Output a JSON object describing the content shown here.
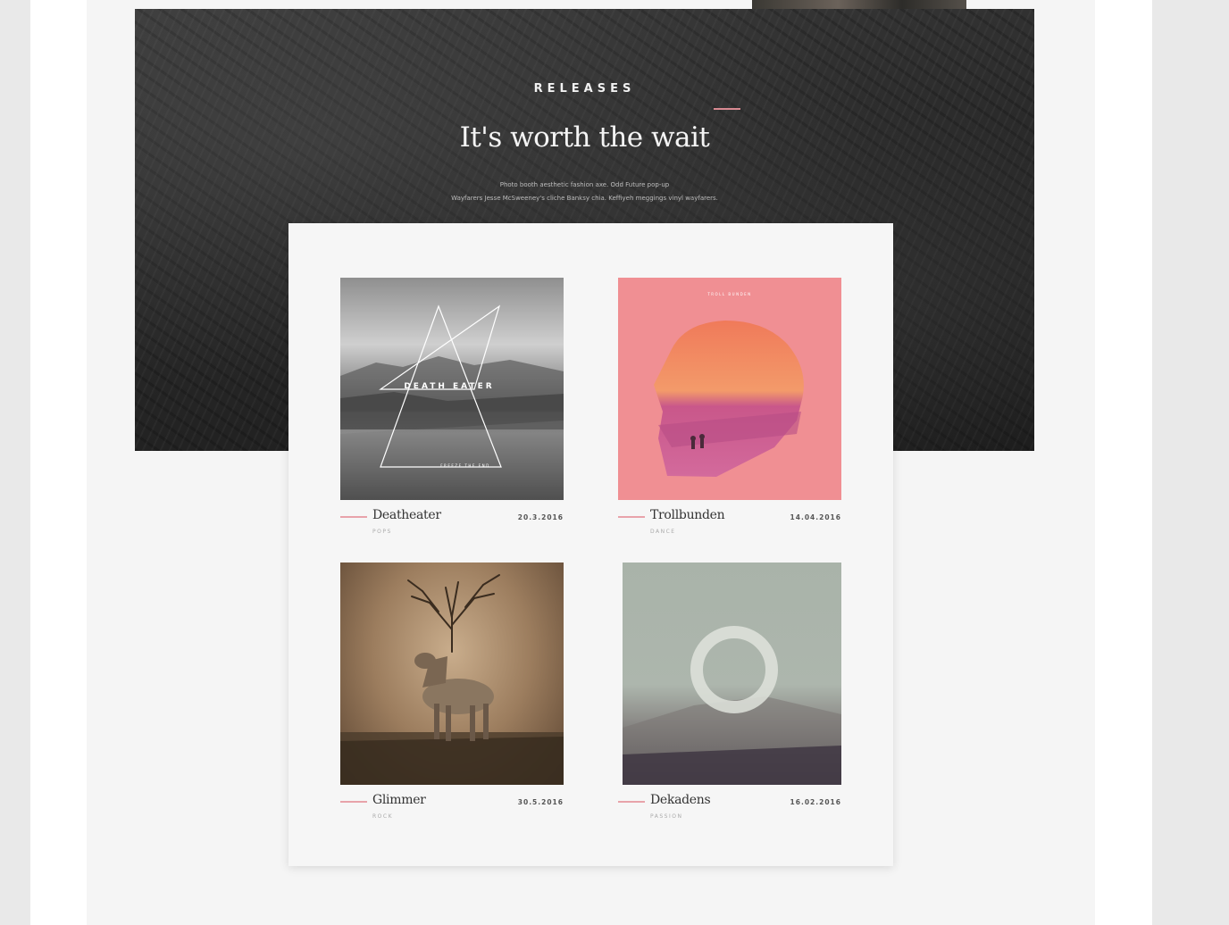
{
  "hero": {
    "eyebrow": "RELEASES",
    "headline": "It's worth the wait",
    "intro_line1": "Photo booth aesthetic fashion axe. Odd Future pop-up",
    "intro_line2": "Wayfarers Jesse McSweeney's cliche Banksy chia. Keffiyeh meggings vinyl wayfarers."
  },
  "releases": [
    {
      "title": "Deatheater",
      "date": "20.3.2016",
      "genre": "POPS",
      "cover_text": "DEATH EATER",
      "cover_caption": "FREEZE THE END"
    },
    {
      "title": "Trollbunden",
      "date": "14.04.2016",
      "genre": "DANCE",
      "cover_text": "TROLL BUNDEN"
    },
    {
      "title": "Glimmer",
      "date": "30.5.2016",
      "genre": "ROCK"
    },
    {
      "title": "Dekadens",
      "date": "16.02.2016",
      "genre": "PASSION"
    }
  ],
  "colors": {
    "accent": "#e8a3aa",
    "hero_bg": "#2a2a2a",
    "card_bg": "#f6f6f6",
    "cover_pink": "#f08f93",
    "cover_sage": "#a9b3a9"
  }
}
